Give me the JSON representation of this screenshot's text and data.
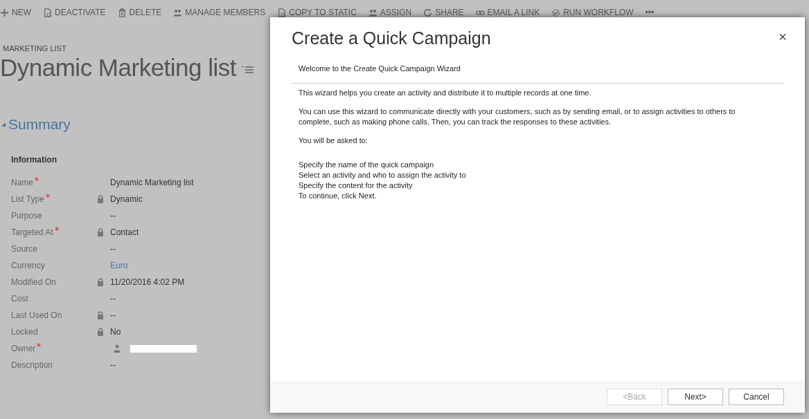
{
  "toolbar": [
    {
      "kind": "plus",
      "label": "NEW"
    },
    {
      "kind": "doc",
      "label": "DEACTIVATE"
    },
    {
      "kind": "trash",
      "label": "DELETE"
    },
    {
      "kind": "people",
      "label": "MANAGE MEMBERS"
    },
    {
      "kind": "doc",
      "label": "COPY TO STATIC"
    },
    {
      "kind": "people",
      "label": "ASSIGN"
    },
    {
      "kind": "share",
      "label": "SHARE"
    },
    {
      "kind": "link",
      "label": "EMAIL A LINK"
    },
    {
      "kind": "workflow",
      "label": "RUN WORKFLOW"
    },
    {
      "kind": "more",
      "label": "•••"
    }
  ],
  "record": {
    "entity": "MARKETING LIST",
    "title": "Dynamic Marketing list"
  },
  "section": {
    "title": "Summary",
    "expanded": true
  },
  "group": "Information",
  "fields": [
    {
      "label": "Name",
      "required": true,
      "locked": false,
      "kind": "text",
      "value": "Dynamic Marketing list"
    },
    {
      "label": "List Type",
      "required": true,
      "locked": true,
      "kind": "text",
      "value": "Dynamic"
    },
    {
      "label": "Purpose",
      "required": false,
      "locked": false,
      "kind": "text",
      "value": "--"
    },
    {
      "label": "Targeted At",
      "required": true,
      "locked": true,
      "kind": "text",
      "value": "Contact"
    },
    {
      "label": "Source",
      "required": false,
      "locked": false,
      "kind": "text",
      "value": "--"
    },
    {
      "label": "Currency",
      "required": false,
      "locked": false,
      "kind": "link",
      "value": "Euro"
    },
    {
      "label": "Modified On",
      "required": false,
      "locked": true,
      "kind": "text",
      "value": "11/20/2016   4:02 PM"
    },
    {
      "label": "Cost",
      "required": false,
      "locked": false,
      "kind": "text",
      "value": "--"
    },
    {
      "label": "Last Used On",
      "required": false,
      "locked": true,
      "kind": "text",
      "value": "--"
    },
    {
      "label": "Locked",
      "required": false,
      "locked": true,
      "kind": "text",
      "value": "No"
    },
    {
      "label": "Owner",
      "required": true,
      "locked": false,
      "kind": "user"
    },
    {
      "label": "Description",
      "required": false,
      "locked": false,
      "kind": "text",
      "value": "--"
    }
  ],
  "dialog": {
    "title": "Create a Quick Campaign",
    "close": "×",
    "heading": "Welcome to the Create Quick Campaign Wizard",
    "paragraphs": [
      "This wizard helps you create an activity and distribute it to multiple records at one time.",
      "You can use this wizard to communicate directly with your customers, such as by sending email, or to assign activities to others to complete, such as making phone calls. Then, you can track the responses to these activities.",
      "You will be asked to:"
    ],
    "steps": [
      "Specify the name of the quick campaign",
      "Select an activity and who to assign the activity to",
      "Specify the content for the activity",
      "To continue, click Next."
    ],
    "buttons": [
      {
        "label": "<Back",
        "disabled": true
      },
      {
        "label": "Next>",
        "disabled": false
      },
      {
        "label": "Cancel",
        "disabled": false
      }
    ]
  }
}
